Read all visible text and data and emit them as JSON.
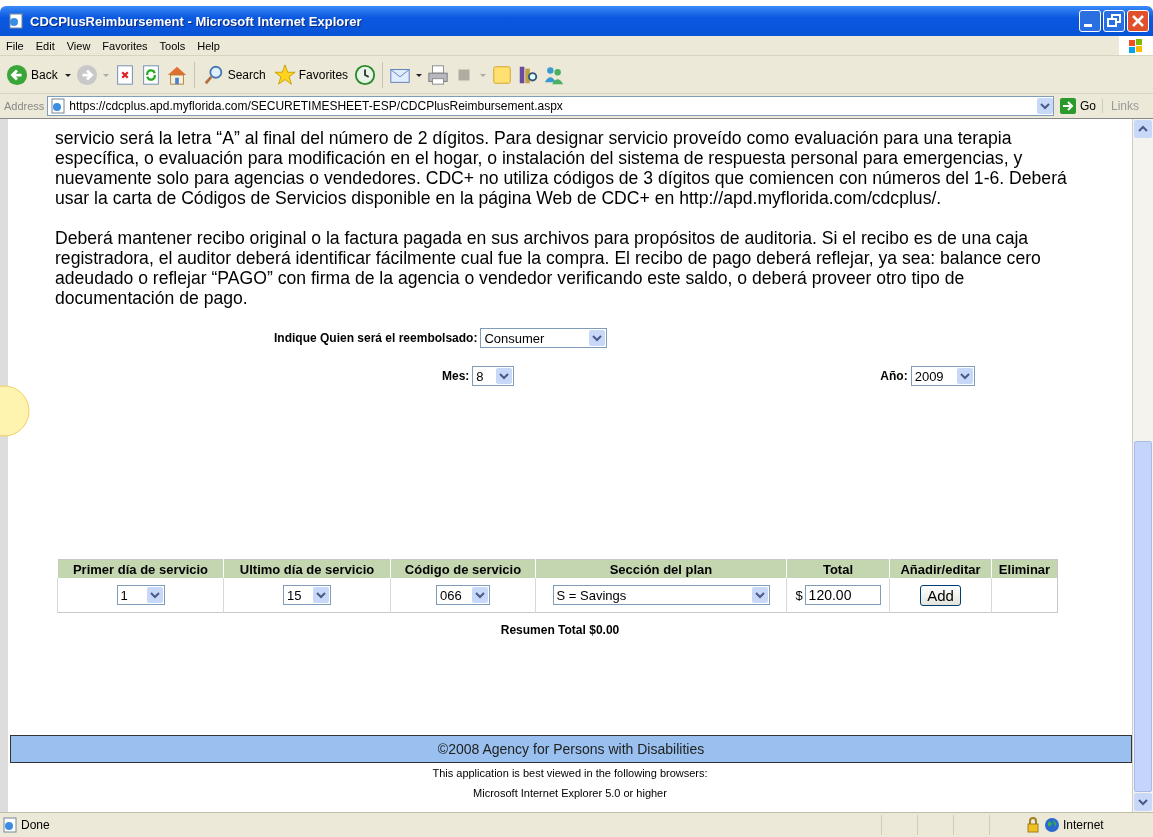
{
  "window": {
    "title": "CDCPlusReimbursement - Microsoft Internet Explorer"
  },
  "menu": [
    "File",
    "Edit",
    "View",
    "Favorites",
    "Tools",
    "Help"
  ],
  "toolbar": {
    "back": "Back",
    "search": "Search",
    "favorites": "Favorites"
  },
  "address_bar": {
    "label": "Address",
    "url": "https://cdcplus.apd.myflorida.com/SECURETIMESHEET-ESP/CDCPlusReimbursement.aspx",
    "go": "Go",
    "links": "Links"
  },
  "page": {
    "paragraphs": [
      "servicio será la letra “A” al final del número de 2 dígitos. Para designar servicio proveído como evaluación para una terapia específica, o evaluación para modificación en el hogar, o instalación del sistema de respuesta personal para emergencias, y nuevamente solo para agencias o vendedores. CDC+ no utiliza códigos de 3 dígitos que comiencen con números del 1-6. Deberá usar la carta de Códigos de Servicios disponible en la página Web de CDC+ en http://apd.myflorida.com/cdcplus/.",
      "Deberá mantener recibo original o la factura pagada en sus archivos para propósitos de auditoria. Si el recibo es de una caja registradora, el auditor deberá identificar fácilmente cual fue la compra. El recibo de pago deberá reflejar, ya sea: balance cero adeudado o reflejar “PAGO” con firma de la agencia o vendedor verificando este saldo, o deberá proveer otro tipo de documentación de pago."
    ],
    "reimbursed": {
      "label": "Indique Quien será el reembolsado:",
      "value": "Consumer"
    },
    "month": {
      "label": "Mes:",
      "value": "8"
    },
    "year": {
      "label": "Año:",
      "value": "2009"
    },
    "table": {
      "columns": [
        "Primer día de servicio",
        "Ultimo día de servicio",
        "Código de servicio",
        "Sección del plan",
        "Total",
        "Añadir/editar",
        "Eliminar"
      ],
      "row": {
        "first_day": "1",
        "last_day": "15",
        "service_code": "066",
        "plan_section": "S = Savings",
        "currency": "$",
        "total": "120.00",
        "button": "Add"
      }
    },
    "summary": "Resumen Total $0.00"
  },
  "footer": {
    "copyright": "©2008 Agency for Persons with Disabilities",
    "notes": [
      "This application is best viewed in the following browsers:",
      "Microsoft Internet Explorer 5.0 or higher"
    ]
  },
  "status_bar": {
    "text": "Done",
    "zone": "Internet"
  }
}
